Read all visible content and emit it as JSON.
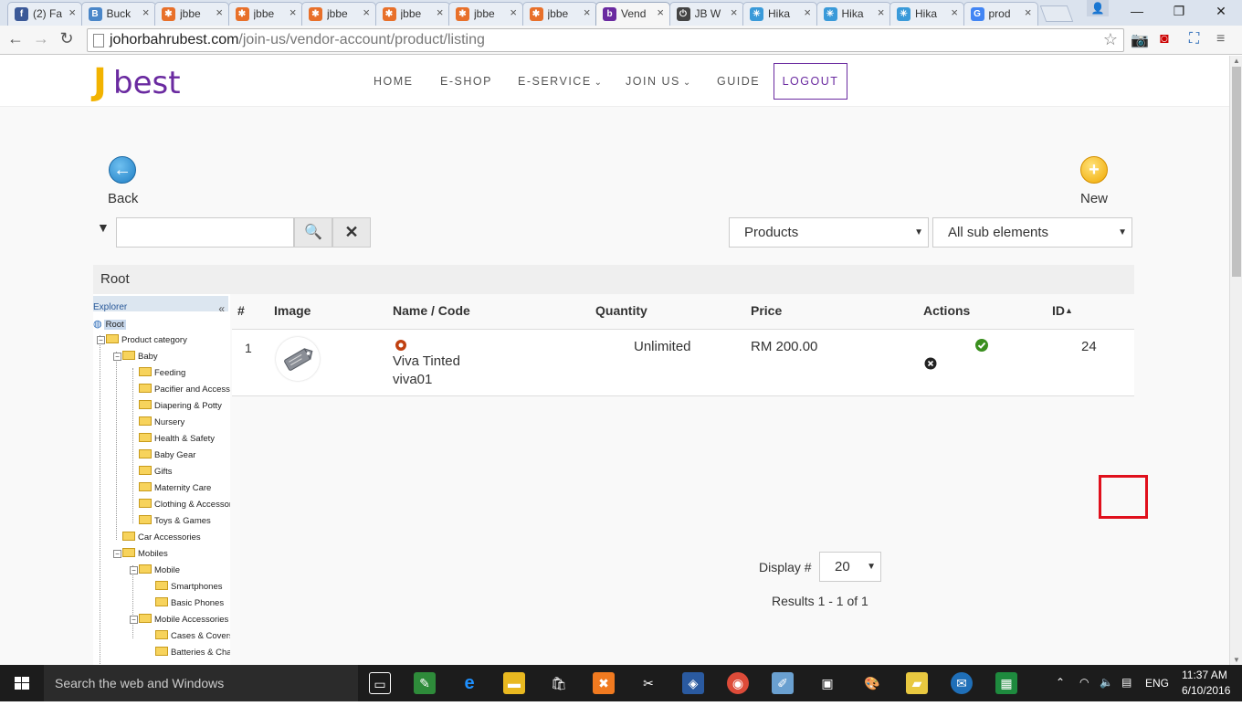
{
  "browser": {
    "tabs": [
      {
        "label": "(2) Fa",
        "icon": "facebook-icon",
        "color": "#3b5998",
        "glyph": "f",
        "active": false
      },
      {
        "label": "Buck",
        "icon": "bucket-icon",
        "color": "#4a86c8",
        "glyph": "B",
        "active": false
      },
      {
        "label": "jbbe",
        "icon": "joomla-icon",
        "color": "#e8702a",
        "glyph": "✱",
        "active": false
      },
      {
        "label": "jbbe",
        "icon": "joomla-icon",
        "color": "#e8702a",
        "glyph": "✱",
        "active": false
      },
      {
        "label": "jbbe",
        "icon": "joomla-icon",
        "color": "#e8702a",
        "glyph": "✱",
        "active": false
      },
      {
        "label": "jbbe",
        "icon": "joomla-icon",
        "color": "#e8702a",
        "glyph": "✱",
        "active": false
      },
      {
        "label": "jbbe",
        "icon": "joomla-icon",
        "color": "#e8702a",
        "glyph": "✱",
        "active": false
      },
      {
        "label": "jbbe",
        "icon": "joomla-icon",
        "color": "#e8702a",
        "glyph": "✱",
        "active": false
      },
      {
        "label": "Vend",
        "icon": "jbest-icon",
        "color": "#6a2aa0",
        "glyph": "b",
        "active": true
      },
      {
        "label": "JB W",
        "icon": "power-icon",
        "color": "#444444",
        "glyph": "⏻",
        "active": false
      },
      {
        "label": "Hika",
        "icon": "hikashop-icon",
        "color": "#3a9ad9",
        "glyph": "✳",
        "active": false
      },
      {
        "label": "Hika",
        "icon": "hikashop-icon",
        "color": "#3a9ad9",
        "glyph": "✳",
        "active": false
      },
      {
        "label": "Hika",
        "icon": "hikashop-icon",
        "color": "#3a9ad9",
        "glyph": "✳",
        "active": false
      },
      {
        "label": "prod",
        "icon": "google-icon",
        "color": "#4285f4",
        "glyph": "G",
        "active": false
      }
    ],
    "url_host": "johorbahrubest.com",
    "url_path": "/join-us/vendor-account/product/listing"
  },
  "site": {
    "logo_j": "J",
    "logo_rest": "best",
    "menu": [
      {
        "label": "HOME",
        "caret": ""
      },
      {
        "label": "E-SHOP",
        "caret": ""
      },
      {
        "label": "E-SERVICE",
        "caret": "⌄"
      },
      {
        "label": "JOIN US",
        "caret": "⌄"
      },
      {
        "label": "GUIDE",
        "caret": ""
      }
    ],
    "logout": "LOGOUT"
  },
  "toolbar": {
    "back_label": "Back",
    "new_label": "New"
  },
  "filters": {
    "search_value": "",
    "type_select": "Products",
    "scope_select": "All sub elements"
  },
  "breadcrumb": "Root",
  "explorer": {
    "title": "Explorer",
    "collapse": "«",
    "nodes": [
      {
        "label": "Root",
        "level": 0,
        "kind": "root"
      },
      {
        "label": "Product category",
        "level": 1,
        "kind": "open"
      },
      {
        "label": "Baby",
        "level": 2,
        "kind": "open"
      },
      {
        "label": "Feeding",
        "level": 3,
        "kind": "leaf"
      },
      {
        "label": "Pacifier and Accessories",
        "level": 3,
        "kind": "leaf"
      },
      {
        "label": "Diapering & Potty",
        "level": 3,
        "kind": "leaf"
      },
      {
        "label": "Nursery",
        "level": 3,
        "kind": "leaf"
      },
      {
        "label": "Health & Safety",
        "level": 3,
        "kind": "leaf"
      },
      {
        "label": "Baby Gear",
        "level": 3,
        "kind": "leaf"
      },
      {
        "label": "Gifts",
        "level": 3,
        "kind": "leaf"
      },
      {
        "label": "Maternity Care",
        "level": 3,
        "kind": "leaf"
      },
      {
        "label": "Clothing & Accessories",
        "level": 3,
        "kind": "leaf"
      },
      {
        "label": "Toys & Games",
        "level": 3,
        "kind": "leaf"
      },
      {
        "label": "Car Accessories",
        "level": 2,
        "kind": "leaf"
      },
      {
        "label": "Mobiles",
        "level": 2,
        "kind": "open"
      },
      {
        "label": "Mobile",
        "level": 3,
        "kind": "open"
      },
      {
        "label": "Smartphones",
        "level": 4,
        "kind": "leaf"
      },
      {
        "label": "Basic Phones",
        "level": 4,
        "kind": "leaf"
      },
      {
        "label": "Mobile Accessories",
        "level": 3,
        "kind": "openb"
      },
      {
        "label": "Cases & Covers",
        "level": 4,
        "kind": "leaf"
      },
      {
        "label": "Batteries & Chargers",
        "level": 4,
        "kind": "leaf"
      }
    ]
  },
  "table": {
    "headers": {
      "num": "#",
      "image": "Image",
      "name": "Name / Code",
      "quantity": "Quantity",
      "price": "Price",
      "actions": "Actions",
      "id": "ID"
    },
    "sort_indicator": "▲",
    "rows": [
      {
        "num": "1",
        "name": "Viva Tinted",
        "code": "viva01",
        "quantity": "Unlimited",
        "price": "RM 200.00",
        "id": "24"
      }
    ]
  },
  "pagination": {
    "display_label": "Display #",
    "display_value": "20",
    "results": "Results 1 - 1 of 1"
  },
  "taskbar": {
    "search_placeholder": "Search the web and Windows",
    "lang": "ENG",
    "time": "11:37 AM",
    "date": "6/10/2016"
  },
  "colors": {
    "brand_purple": "#6a2aa0",
    "brand_yellow": "#f2b300",
    "highlight_red": "#e0101c",
    "publish_green": "#3a8f1e"
  }
}
